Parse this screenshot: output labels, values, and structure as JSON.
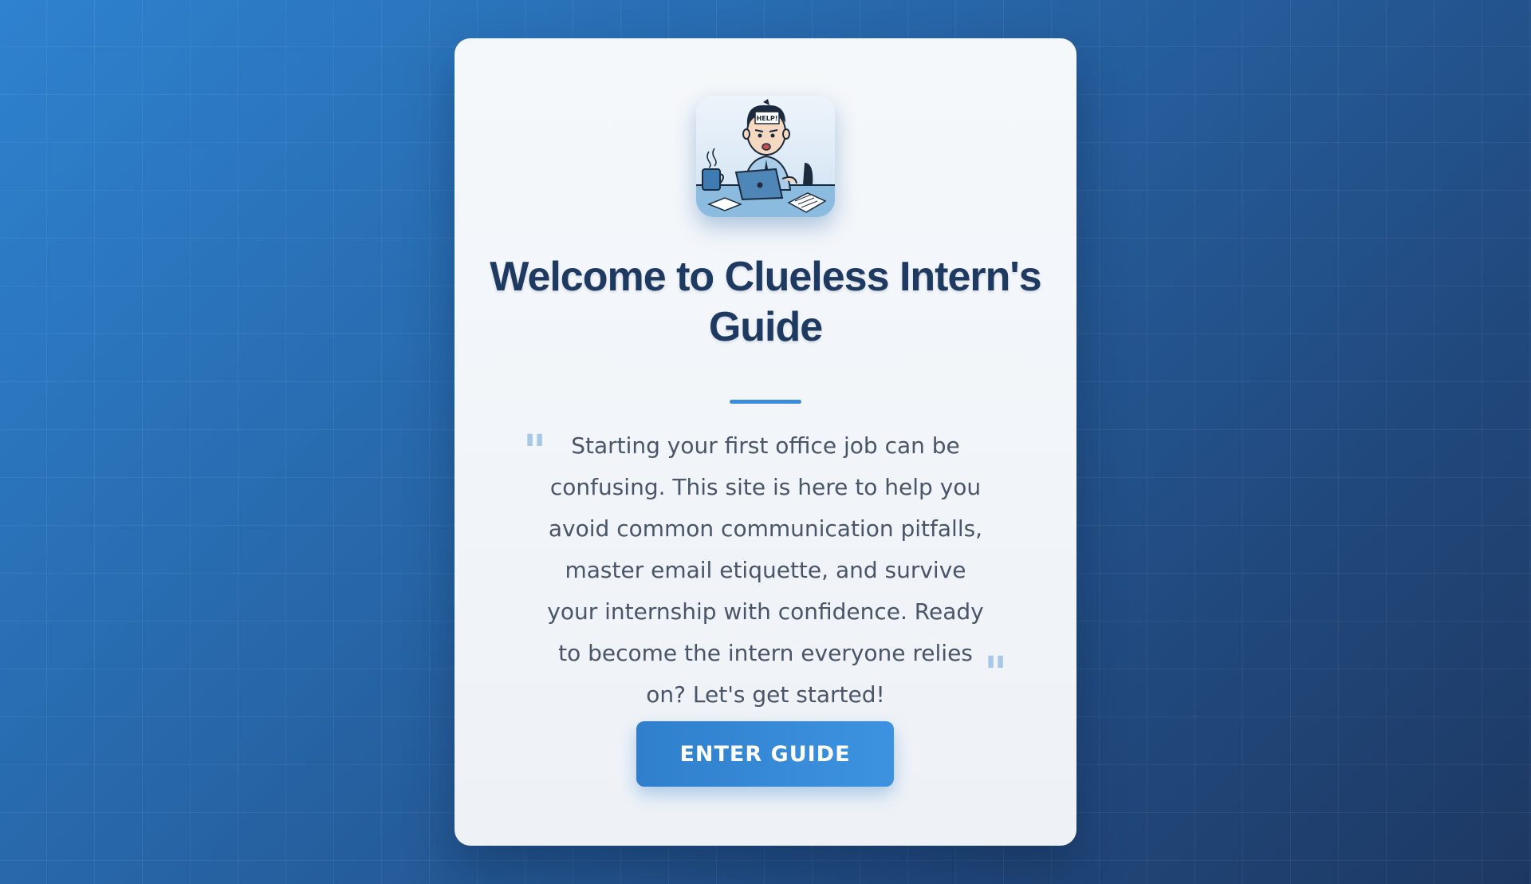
{
  "page": {
    "title": "Welcome to Clueless Intern's Guide",
    "intro": "Starting your first office job can be confusing. This site is here to help you avoid common communication pitfalls, master email etiquette, and survive your internship with confidence. Ready to become the intern everyone relies on? Let's get started!",
    "cta_label": "ENTER GUIDE",
    "mascot_sign_text": "HELP!"
  },
  "icons": {
    "mascot": "stressed-intern-illustration",
    "quote_open": "quote-open-icon",
    "quote_close": "quote-close-icon"
  },
  "colors": {
    "background_start": "#2e82cf",
    "background_end": "#1d3862",
    "card_background": "#f3f6fa",
    "title": "#1f3a60",
    "accent": "#3b8ddb",
    "body_text": "#4a5568",
    "quote_marks": "#a9c8e8"
  }
}
